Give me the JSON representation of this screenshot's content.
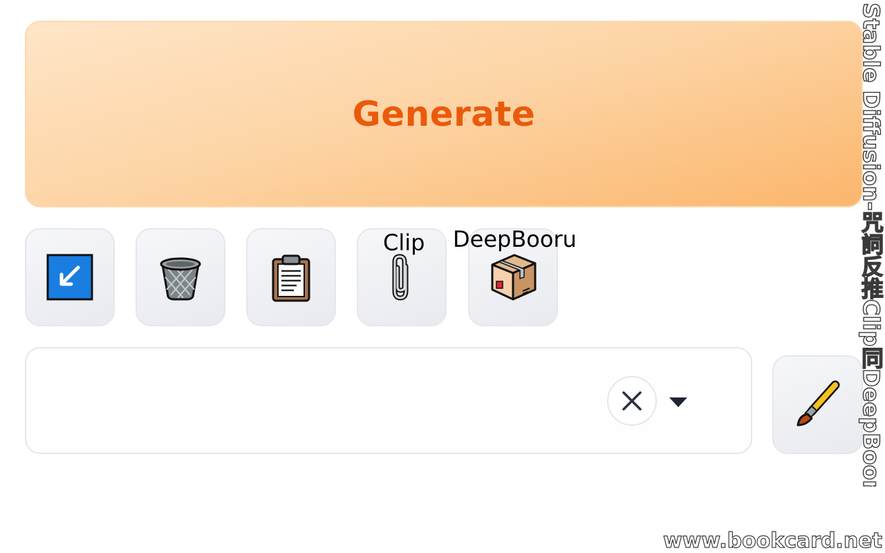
{
  "generate": {
    "label": "Generate"
  },
  "tools": [
    {
      "icon": "arrow-down-left-icon",
      "label": ""
    },
    {
      "icon": "wastebasket-icon",
      "label": ""
    },
    {
      "icon": "clipboard-icon",
      "label": ""
    },
    {
      "icon": "paperclip-icon",
      "label": "Clip"
    },
    {
      "icon": "package-box-icon",
      "label": "DeepBooru"
    }
  ],
  "style_select": {
    "value": ""
  },
  "paint_button": {
    "icon": "paintbrush-icon"
  },
  "watermark": {
    "vertical_title": "Stable Diffusion-咒詞反推Clip同DeepBooru",
    "site_url": "www.bookcard.net"
  },
  "colors": {
    "generate_text": "#ea5a0c",
    "generate_bg_start": "#fee6c8",
    "generate_bg_end": "#fbb66c",
    "button_bg": "#eceef2",
    "border": "#e6e7ec"
  }
}
